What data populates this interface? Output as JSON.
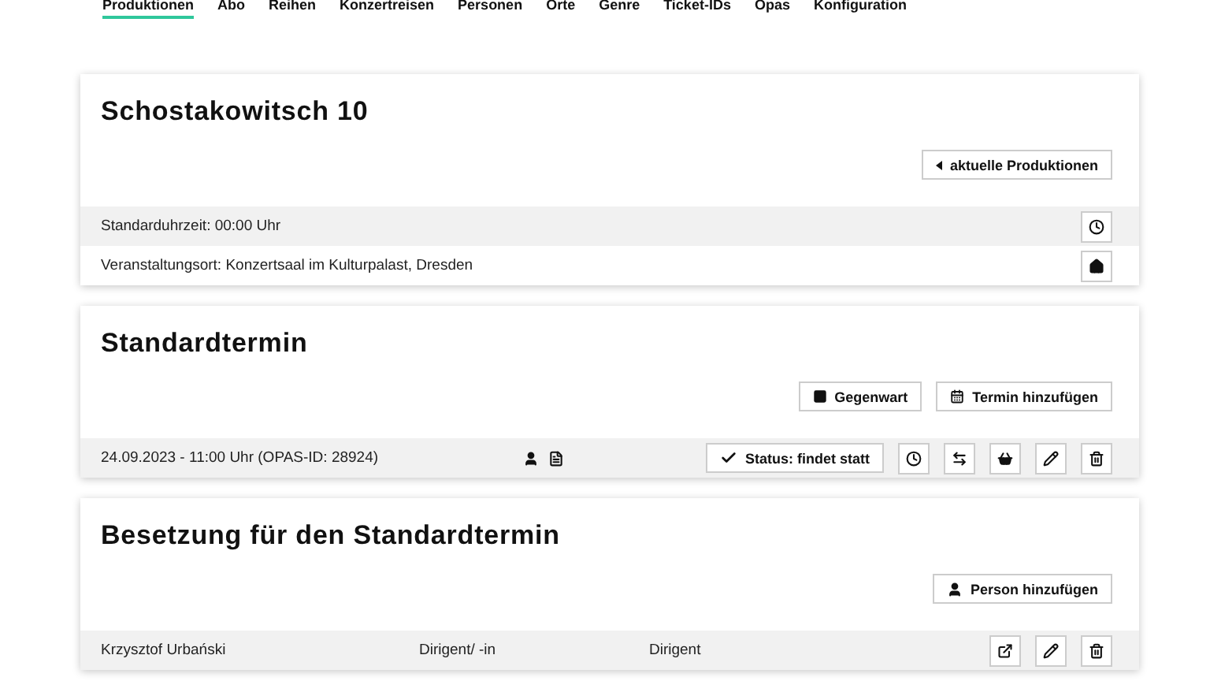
{
  "nav": [
    {
      "label": "Produktionen",
      "selected": true
    },
    {
      "label": "Abo",
      "selected": false
    },
    {
      "label": "Reihen",
      "selected": false
    },
    {
      "label": "Konzertreisen",
      "selected": false
    },
    {
      "label": "Personen",
      "selected": false
    },
    {
      "label": "Orte",
      "selected": false
    },
    {
      "label": "Genre",
      "selected": false
    },
    {
      "label": "Ticket-IDs",
      "selected": false
    },
    {
      "label": "Opas",
      "selected": false
    },
    {
      "label": "Konfiguration",
      "selected": false
    }
  ],
  "production": {
    "title": "Schostakowitsch 10",
    "back_button": "aktuelle Produktionen",
    "info_rows": [
      {
        "text": "Standarduhrzeit: 00:00 Uhr",
        "kind": "clock"
      },
      {
        "text": "Veranstaltungsort: Konzertsaal im Kulturpalast, Dresden",
        "kind": "home"
      }
    ]
  },
  "standard": {
    "title": "Standardtermin",
    "buttons": [
      {
        "label": "Gegenwart",
        "kind": "square"
      },
      {
        "label": "Termin hinzufügen",
        "kind": "calendar"
      }
    ],
    "dates": [
      {
        "text": "24.09.2023 - 11:00 Uhr (OPAS-ID: 28924)",
        "indicators": [
          {
            "kind": "person"
          },
          {
            "kind": "document"
          }
        ],
        "status": "Status: findet statt",
        "actions": [
          {
            "kind": "clock"
          },
          {
            "kind": "swap"
          },
          {
            "kind": "basket"
          },
          {
            "kind": "edit"
          },
          {
            "kind": "delete"
          }
        ]
      }
    ]
  },
  "cast": {
    "title": "Besetzung für den Standardtermin",
    "add_button": "Person hinzufügen",
    "rows": [
      {
        "name": "Krzysztof Urbański",
        "role": "Dirigent/ -in",
        "function": "Dirigent",
        "actions": [
          {
            "kind": "open"
          },
          {
            "kind": "edit"
          },
          {
            "kind": "delete"
          }
        ]
      }
    ]
  }
}
